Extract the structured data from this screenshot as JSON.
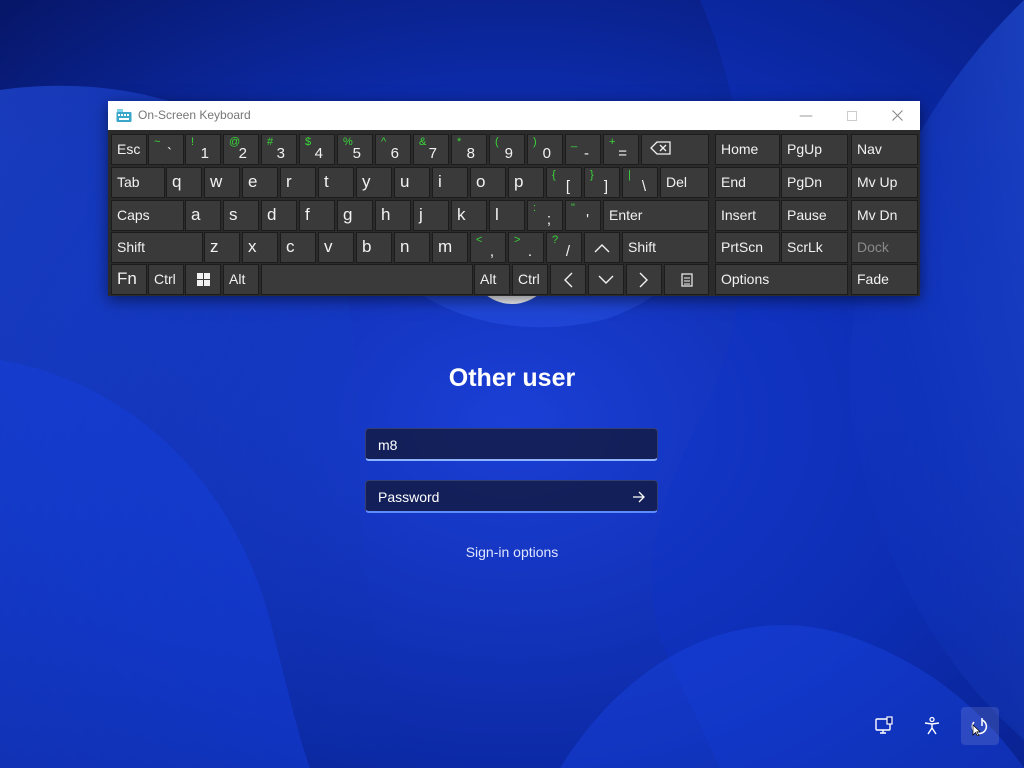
{
  "colors": {
    "desktop_bg": "#0a1f8f",
    "key_bg": "#3a3a3a",
    "shift_symbol": "#39d63a",
    "field_focus": "#5c8cff"
  },
  "osk": {
    "title": "On-Screen Keyboard",
    "app_icon": "keyboard-icon",
    "rows": {
      "row1": [
        {
          "label": "Esc"
        },
        {
          "sym": "~",
          "main": "`"
        },
        {
          "sym": "!",
          "main": "1"
        },
        {
          "sym": "@",
          "main": "2"
        },
        {
          "sym": "#",
          "main": "3"
        },
        {
          "sym": "$",
          "main": "4"
        },
        {
          "sym": "%",
          "main": "5"
        },
        {
          "sym": "^",
          "main": "6"
        },
        {
          "sym": "&",
          "main": "7"
        },
        {
          "sym": "*",
          "main": "8"
        },
        {
          "sym": "(",
          "main": "9"
        },
        {
          "sym": ")",
          "main": "0"
        },
        {
          "sym": "_",
          "main": "-"
        },
        {
          "sym": "+",
          "main": "="
        },
        {
          "icon": "backspace-icon"
        }
      ],
      "row2": [
        {
          "label": "Tab"
        },
        {
          "label": "q"
        },
        {
          "label": "w"
        },
        {
          "label": "e"
        },
        {
          "label": "r"
        },
        {
          "label": "t"
        },
        {
          "label": "y"
        },
        {
          "label": "u"
        },
        {
          "label": "i"
        },
        {
          "label": "o"
        },
        {
          "label": "p"
        },
        {
          "sym": "{",
          "main": "["
        },
        {
          "sym": "}",
          "main": "]"
        },
        {
          "sym": "|",
          "main": "\\"
        },
        {
          "label": "Del"
        }
      ],
      "row3": [
        {
          "label": "Caps"
        },
        {
          "label": "a"
        },
        {
          "label": "s"
        },
        {
          "label": "d"
        },
        {
          "label": "f"
        },
        {
          "label": "g"
        },
        {
          "label": "h"
        },
        {
          "label": "j"
        },
        {
          "label": "k"
        },
        {
          "label": "l"
        },
        {
          "sym": ":",
          "main": ";"
        },
        {
          "sym": "\"",
          "main": "'"
        },
        {
          "label": "Enter"
        }
      ],
      "row4": [
        {
          "label": "Shift"
        },
        {
          "label": "z"
        },
        {
          "label": "x"
        },
        {
          "label": "c"
        },
        {
          "label": "v"
        },
        {
          "label": "b"
        },
        {
          "label": "n"
        },
        {
          "label": "m"
        },
        {
          "sym": "<",
          "main": ","
        },
        {
          "sym": ">",
          "main": "."
        },
        {
          "sym": "?",
          "main": "/"
        },
        {
          "icon": "arrow-up-icon"
        },
        {
          "label": "Shift"
        }
      ],
      "row5": [
        {
          "label": "Fn"
        },
        {
          "label": "Ctrl"
        },
        {
          "icon": "windows-logo-icon"
        },
        {
          "label": "Alt"
        },
        {
          "label": ""
        },
        {
          "label": "Alt"
        },
        {
          "label": "Ctrl"
        },
        {
          "icon": "arrow-left-icon"
        },
        {
          "icon": "arrow-down-icon"
        },
        {
          "icon": "arrow-right-icon"
        },
        {
          "icon": "context-menu-icon"
        }
      ]
    },
    "nav_keys": {
      "home": "Home",
      "pgup": "PgUp",
      "nav": "Nav",
      "end": "End",
      "pgdn": "PgDn",
      "mvup": "Mv Up",
      "insert": "Insert",
      "pause": "Pause",
      "mvdn": "Mv Dn",
      "prtscn": "PrtScn",
      "scrlk": "ScrLk",
      "dock": "Dock",
      "options": "Options",
      "fade": "Fade"
    }
  },
  "login": {
    "username": "Other user",
    "username_value": "m8",
    "password_placeholder": "Password",
    "signin_options": "Sign-in options"
  },
  "tray": [
    "network-icon",
    "accessibility-icon",
    "power-icon"
  ]
}
